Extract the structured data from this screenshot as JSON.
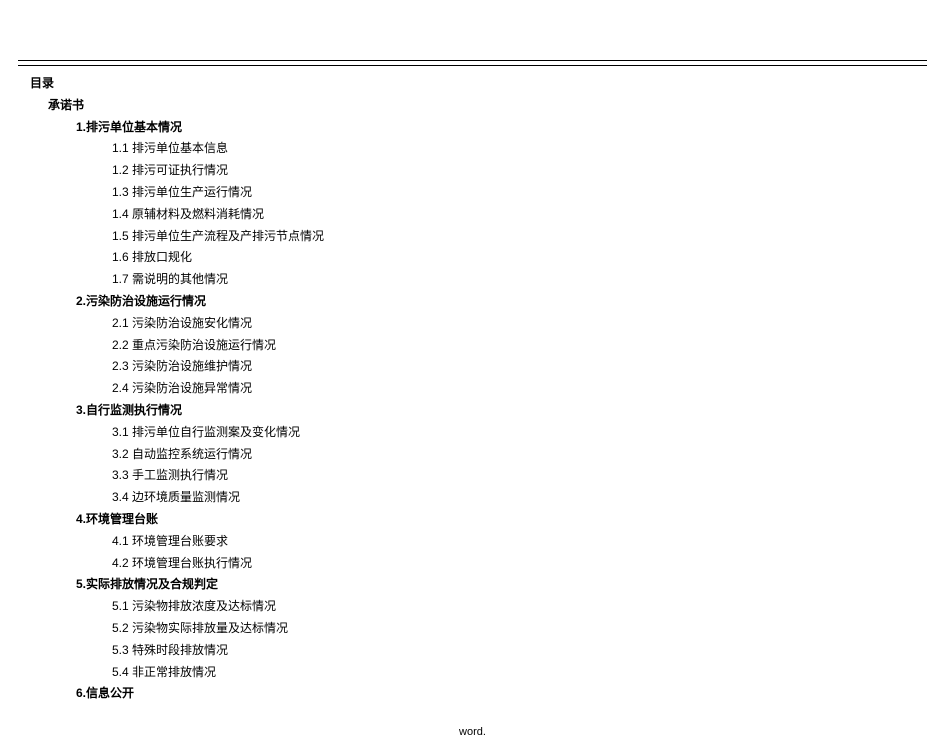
{
  "toc_title": "目录",
  "sections": {
    "cover": "承诺书",
    "s1": {
      "title": "1.排污单位基本情况",
      "items": {
        "i1": "1.1 排污单位基本信息",
        "i2": "1.2 排污可证执行情况",
        "i3": "1.3 排污单位生产运行情况",
        "i4": "1.4 原辅材料及燃料消耗情况",
        "i5": "1.5 排污单位生产流程及产排污节点情况",
        "i6": "1.6 排放口规化",
        "i7": "1.7 需说明的其他情况"
      }
    },
    "s2": {
      "title": "2.污染防治设施运行情况",
      "items": {
        "i1": "2.1 污染防治设施安化情况",
        "i2": "2.2 重点污染防治设施运行情况",
        "i3": "2.3 污染防治设施维护情况",
        "i4": "2.4 污染防治设施异常情况"
      }
    },
    "s3": {
      "title": "3.自行监测执行情况",
      "items": {
        "i1": "3.1 排污单位自行监测案及变化情况",
        "i2": "3.2 自动监控系统运行情况",
        "i3": "3.3 手工监测执行情况",
        "i4": "3.4 边环境质量监测情况"
      }
    },
    "s4": {
      "title": "4.环境管理台账",
      "items": {
        "i1": "4.1 环境管理台账要求",
        "i2": "4.2 环境管理台账执行情况"
      }
    },
    "s5": {
      "title": "5.实际排放情况及合规判定",
      "items": {
        "i1": "5.1 污染物排放浓度及达标情况",
        "i2": "5.2 污染物实际排放量及达标情况",
        "i3": "5.3 特殊时段排放情况",
        "i4": "5.4 非正常排放情况"
      }
    },
    "s6": {
      "title": "6.信息公开"
    }
  },
  "footer": "word."
}
